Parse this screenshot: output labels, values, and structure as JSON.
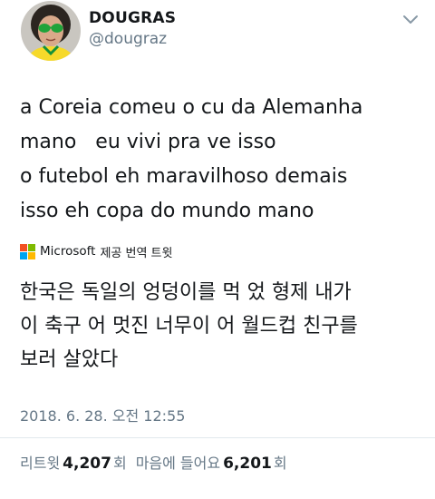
{
  "user": {
    "display_name": "DOUGRAS",
    "handle": "@dougraz"
  },
  "tweet": {
    "lines": [
      "a Coreia comeu o cu da Alemanha",
      "mano   eu vivi pra ve isso",
      "o futebol eh maravilhoso demais",
      "isso eh copa do mundo mano"
    ]
  },
  "translation": {
    "provider": "Microsoft",
    "label": "제공 번역 트윗",
    "lines": [
      "한국은 독일의 엉덩이를 먹 었 형제 내가",
      "이 축구 어 멋진 너무이 어 월드컵 친구를",
      "보러 살았다"
    ]
  },
  "timestamp": "2018. 6. 28. 오전 12:55",
  "stats": {
    "retweets_label": "리트윗",
    "retweets_count": "4,207",
    "retweets_suffix": "회",
    "likes_label": "마음에 들어요",
    "likes_count": "6,201",
    "likes_suffix": "회"
  },
  "icons": {
    "menu": "chevron-down-icon",
    "logo": "microsoft-logo-icon"
  },
  "colors": {
    "text": "#14171a",
    "secondary": "#657786",
    "divider": "#e1e8ed",
    "ms_red": "#f25022",
    "ms_green": "#7fba00",
    "ms_blue": "#00a4ef",
    "ms_yellow": "#ffb900"
  }
}
